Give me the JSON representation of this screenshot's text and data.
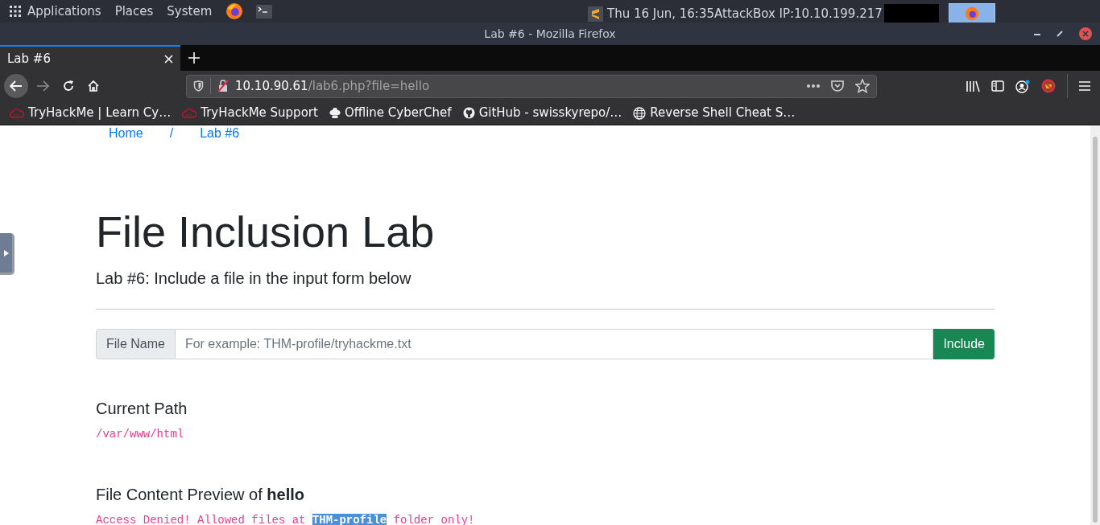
{
  "top_panel": {
    "menus": [
      "Applications",
      "Places",
      "System"
    ],
    "clock": "Thu 16 Jun, 16:35",
    "ip": "AttackBox IP:10.10.199.217"
  },
  "window": {
    "title": "Lab #6 - Mozilla Firefox"
  },
  "tabs": [
    {
      "label": "Lab #6",
      "selected": true
    }
  ],
  "url": {
    "host": "10.10.90.61",
    "path": "/lab6.php?file=hello"
  },
  "bookmarks": [
    {
      "kind": "cloud",
      "label": "TryHackMe | Learn Cy…"
    },
    {
      "kind": "cloud",
      "label": "TryHackMe Support"
    },
    {
      "kind": "chef",
      "label": "Offline CyberChef"
    },
    {
      "kind": "github",
      "label": "GitHub - swisskyrepo/…"
    },
    {
      "kind": "globe",
      "label": "Reverse Shell Cheat S…"
    }
  ],
  "breadcrumb": [
    "Home",
    "/",
    "Lab #6"
  ],
  "heading": "File Inclusion Lab",
  "subtitle": "Lab #6: Include a file in the input form below",
  "form": {
    "label": "File Name",
    "placeholder": "For example: THM-profile/tryhackme.txt",
    "button": "Include"
  },
  "current_path": {
    "title": "Current Path",
    "value": "/var/www/html"
  },
  "preview": {
    "title": "File Content Preview of **hello**",
    "message": "Access Denied! Allowed files at **THM-profile** folder only!"
  }
}
